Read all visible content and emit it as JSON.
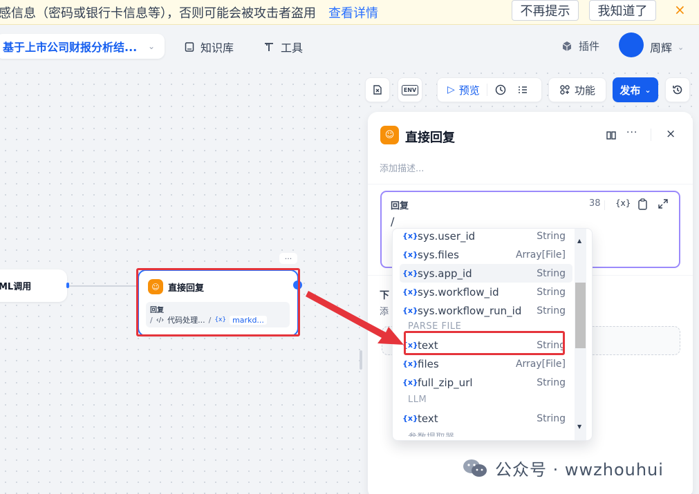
{
  "banner": {
    "text": "感信息（密码或银行卡信息等），否则可能会被攻击者盗用",
    "link": "查看详情",
    "dont_remind": "不再提示",
    "got_it": "我知道了",
    "close_icon": "×"
  },
  "header": {
    "app_name": "基于上市公司财报分析结...",
    "nav": [
      {
        "label": "知识库",
        "icon": "book-icon"
      },
      {
        "label": "工具",
        "icon": "tool-icon"
      }
    ],
    "plugins": "插件",
    "user_name": "周辉"
  },
  "toolbar": {
    "preview": "预览",
    "features": "功能",
    "publish": "发布",
    "env": "ENV"
  },
  "canvas": {
    "prev_node_label": "ML调用",
    "node": {
      "title": "直接回复",
      "reply_label": "回复",
      "tag_code": "代码处理...",
      "tag_var": "markd...",
      "more": "···"
    }
  },
  "panel": {
    "title": "直接回复",
    "description_placeholder": "添加描述...",
    "reply_label": "回复",
    "char_count": "38",
    "var_icon": "{x}",
    "editor_text": "/",
    "next_label": "下",
    "add_label": "添"
  },
  "dropdown": {
    "items": [
      {
        "name": "sys.user_id",
        "type": "String"
      },
      {
        "name": "sys.files",
        "type": "Array[File]"
      },
      {
        "name": "sys.app_id",
        "type": "String"
      },
      {
        "name": "sys.workflow_id",
        "type": "String"
      },
      {
        "name": "sys.workflow_run_id",
        "type": "String"
      }
    ],
    "group_parse": "PARSE FILE",
    "parse_items": [
      {
        "name": "text",
        "type": "String"
      },
      {
        "name": "files",
        "type": "Array[File]"
      },
      {
        "name": "full_zip_url",
        "type": "String"
      }
    ],
    "group_llm": "LLM",
    "llm_items": [
      {
        "name": "text",
        "type": "String"
      }
    ],
    "group_next": "参数提取器"
  },
  "watermark": "公众号 · wwzhouhui",
  "colors": {
    "accent": "#155eef",
    "node_icon": "#f79009",
    "highlight": "#e5343b"
  }
}
